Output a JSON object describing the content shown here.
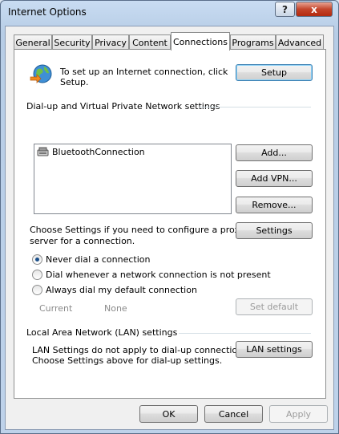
{
  "window": {
    "title": "Internet Options",
    "help_label": "?",
    "close_label": "x"
  },
  "tabs": [
    {
      "label": "General"
    },
    {
      "label": "Security"
    },
    {
      "label": "Privacy"
    },
    {
      "label": "Content"
    },
    {
      "label": "Connections",
      "active": true
    },
    {
      "label": "Programs"
    },
    {
      "label": "Advanced"
    }
  ],
  "setup": {
    "text": "To set up an Internet connection, click Setup.",
    "text_line1": "To set up an Internet connection, click",
    "text_line2": "Setup.",
    "button": "Setup"
  },
  "dialup": {
    "heading": "Dial-up and Virtual Private Network settings",
    "connections": [
      {
        "name": "BluetoothConnection"
      }
    ],
    "add_button": "Add...",
    "add_vpn_button": "Add VPN...",
    "remove_button": "Remove...",
    "settings_text_line1": "Choose Settings if you need to configure a proxy",
    "settings_text_line2": "server for a connection.",
    "settings_button": "Settings",
    "options": [
      {
        "label": "Never dial a connection",
        "checked": true
      },
      {
        "label": "Dial whenever a network connection is not present",
        "checked": false
      },
      {
        "label": "Always dial my default connection",
        "checked": false
      }
    ],
    "current_label": "Current",
    "current_value": "None",
    "set_default_button": "Set default"
  },
  "lan": {
    "heading": "Local Area Network (LAN) settings",
    "text_line1": "LAN Settings do not apply to dial-up connections.",
    "text_line2": "Choose Settings above for dial-up settings.",
    "button": "LAN settings"
  },
  "footer": {
    "ok": "OK",
    "cancel": "Cancel",
    "apply": "Apply"
  }
}
